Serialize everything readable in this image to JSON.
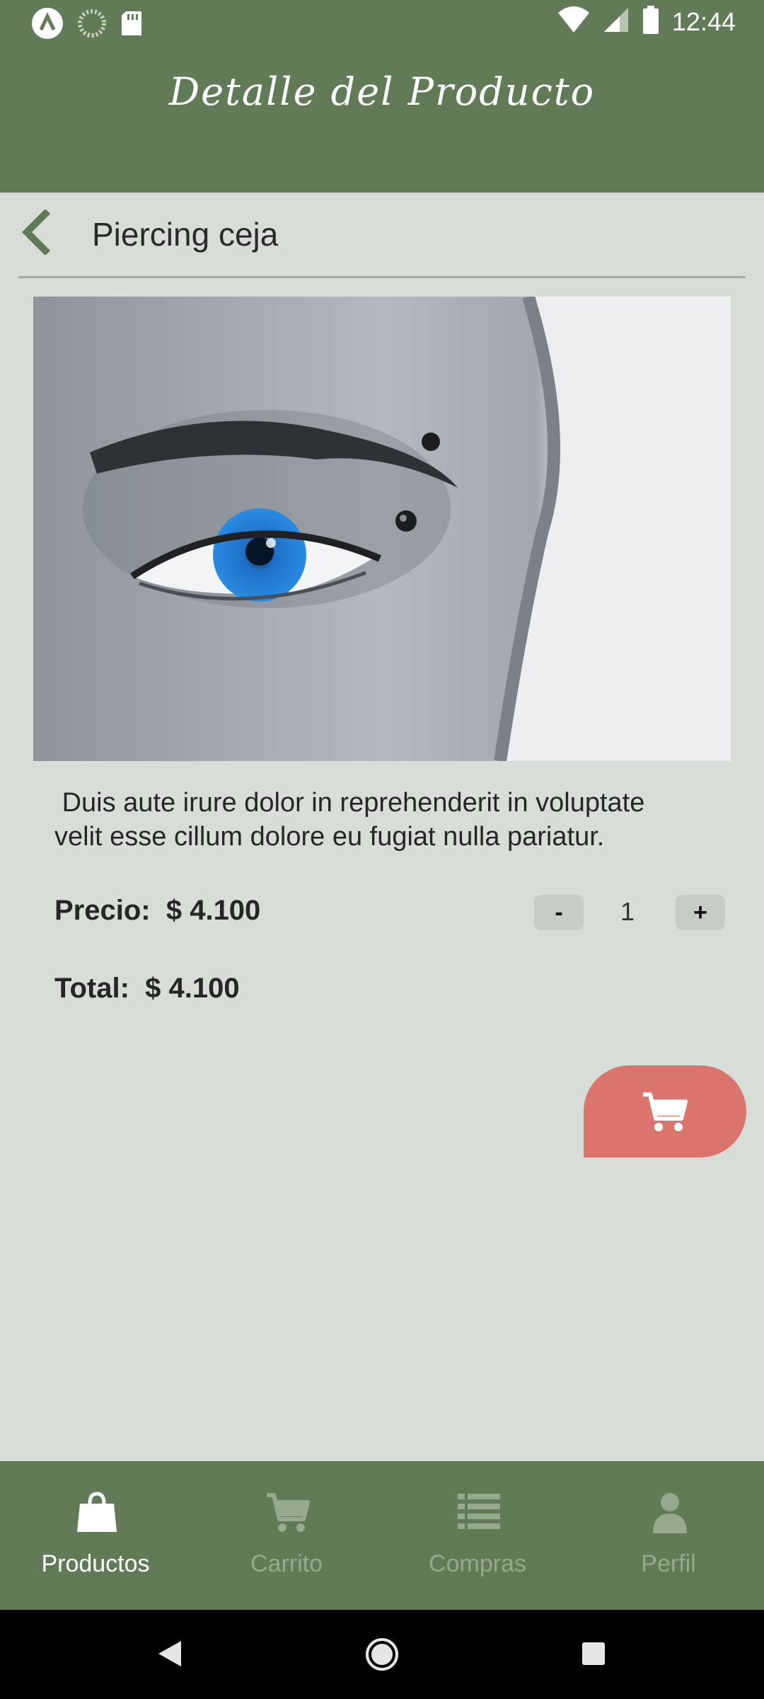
{
  "status_bar": {
    "time": "12:44",
    "icons": [
      "app-notification-icon",
      "loading-icon",
      "sd-card-icon",
      "wifi-icon",
      "signal-icon",
      "battery-icon"
    ]
  },
  "app_bar": {
    "title": "Detalle del Producto"
  },
  "product": {
    "name": "Piercing ceja",
    "image": "close-up of eye with eyebrow piercing",
    "description": " Duis aute irure dolor in reprehenderit in voluptate\nvelit esse cillum dolore eu fugiat nulla pariatur.",
    "price_label": "Precio:",
    "price_value": "$ 4.100",
    "total_label": "Total:",
    "total_value": "$ 4.100"
  },
  "quantity": {
    "minus_label": "-",
    "value": "1",
    "plus_label": "+"
  },
  "cart_button": {
    "icon": "cart-icon"
  },
  "bottom_nav": {
    "items": [
      {
        "label": "Productos",
        "icon": "shopping-bag-icon",
        "active": true
      },
      {
        "label": "Carrito",
        "icon": "cart-icon",
        "active": false
      },
      {
        "label": "Compras",
        "icon": "list-icon",
        "active": false
      },
      {
        "label": "Perfil",
        "icon": "person-icon",
        "active": false
      }
    ]
  },
  "colors": {
    "primary": "#627b57",
    "background": "#d9ddd8",
    "accent": "#d9756d",
    "inactive_nav": "#97a98d"
  }
}
